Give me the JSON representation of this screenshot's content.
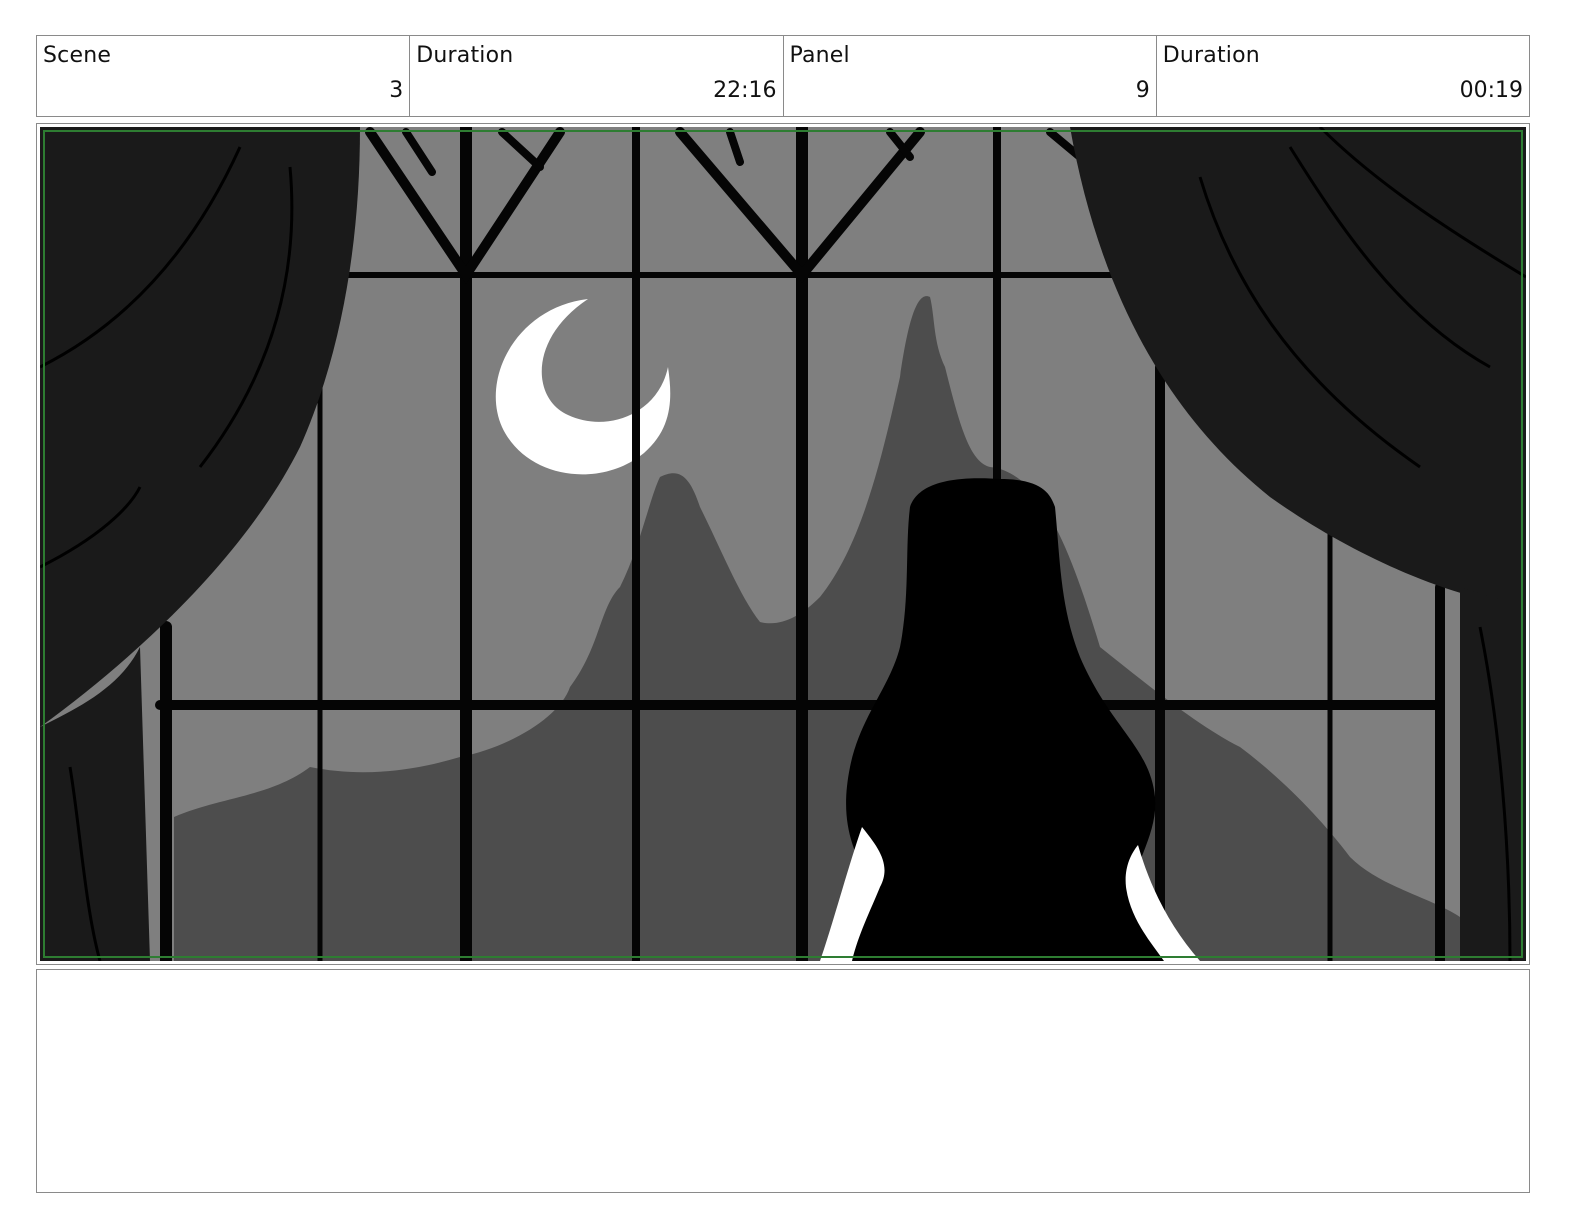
{
  "header": {
    "scene_label": "Scene",
    "scene_value": "3",
    "scene_duration_label": "Duration",
    "scene_duration_value": "22:16",
    "panel_label": "Panel",
    "panel_value": "9",
    "panel_duration_label": "Duration",
    "panel_duration_value": "00:19"
  },
  "colors": {
    "frame_guide": "#2e7d32",
    "sky": "#7f7f7f",
    "mountain": "#4d4d4d",
    "curtain": "#1a1a1a",
    "silhouette": "#000000",
    "moon": "#ffffff"
  },
  "notes": {
    "text": ""
  }
}
